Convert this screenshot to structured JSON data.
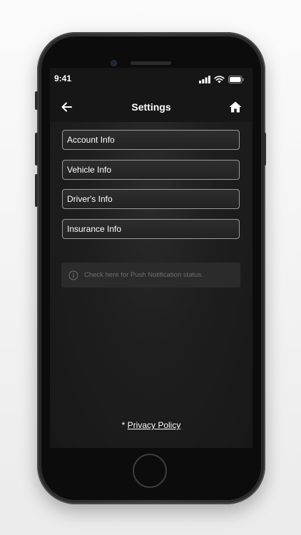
{
  "status_bar": {
    "time": "9:41"
  },
  "nav": {
    "title": "Settings",
    "back_icon": "arrow-left-icon",
    "home_icon": "home-icon"
  },
  "menu": {
    "items": [
      {
        "label": "Account Info"
      },
      {
        "label": "Vehicle Info"
      },
      {
        "label": "Driver's Info"
      },
      {
        "label": "Insurance Info"
      }
    ]
  },
  "notice": {
    "icon": "info-icon",
    "text": "Check here for Push Notification status."
  },
  "footer": {
    "prefix": "* ",
    "privacy_link": "Privacy Policy"
  },
  "colors": {
    "screen_background": "#161616",
    "text": "#ffffff",
    "item_border": "#9a9a9a",
    "notice_background": "#2b2b2b",
    "notice_text": "#6f6f6f"
  }
}
